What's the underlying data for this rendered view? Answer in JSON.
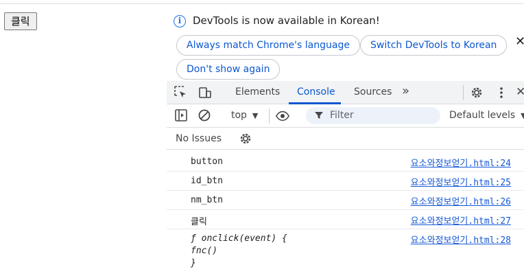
{
  "page": {
    "button_label": "클릭"
  },
  "banner": {
    "message": "DevTools is now available in Korean!",
    "buttons": [
      "Always match Chrome's language",
      "Switch DevTools to Korean",
      "Don't show again"
    ],
    "close": "✕"
  },
  "toolbar": {
    "tabs": [
      "Elements",
      "Console",
      "Sources"
    ],
    "active_tab": "Console",
    "more": "»"
  },
  "filterbar": {
    "context": "top",
    "filter_placeholder": "Filter",
    "levels": "Default levels"
  },
  "issues": {
    "label": "No Issues"
  },
  "logs": [
    {
      "message": "button",
      "source": "요소와정보얻기.html:24"
    },
    {
      "message": "id_btn",
      "source": "요소와정보얻기.html:25"
    },
    {
      "message": "nm_btn",
      "source": "요소와정보얻기.html:26"
    },
    {
      "message": "클릭",
      "source": "요소와정보얻기.html:27"
    },
    {
      "message_lines": [
        "ƒ onclick(event) {",
        "fnc()",
        "}"
      ],
      "source": "요소와정보얻기.html:28"
    }
  ],
  "colors": {
    "accent": "#0b57d0",
    "toolbar_bg": "#f1f3f4",
    "filter_bg": "#edf2fa"
  }
}
